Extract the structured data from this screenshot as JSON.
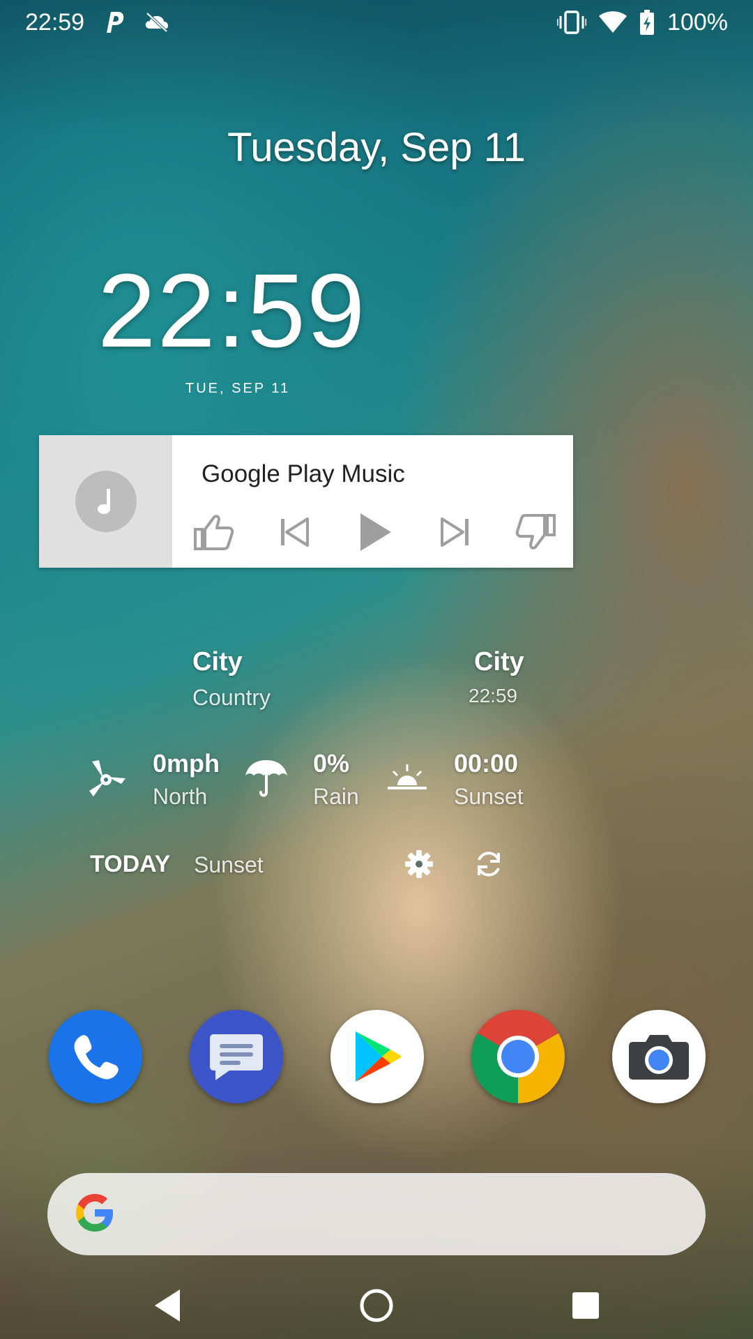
{
  "status_bar": {
    "time": "22:59",
    "battery": "100%",
    "icons": [
      "p-notification-icon",
      "cloud-off-icon",
      "vibrate-icon",
      "wifi-icon",
      "battery-charging-icon"
    ]
  },
  "glance": {
    "date": "Tuesday, Sep 11"
  },
  "clock": {
    "time": "22:59",
    "date": "TUE, SEP 11"
  },
  "music_widget": {
    "title": "Google Play Music",
    "controls": [
      "thumbs-up-icon",
      "skip-previous-icon",
      "play-icon",
      "skip-next-icon",
      "thumbs-down-icon"
    ]
  },
  "weather": {
    "location_city": "City",
    "location_country": "Country",
    "right_city": "City",
    "right_time": "22:59",
    "wind_value": "0mph",
    "wind_dir": "North",
    "rain_value": "0%",
    "rain_label": "Rain",
    "sunset_value": "00:00",
    "sunset_label": "Sunset",
    "today_label": "TODAY",
    "today_value": "Sunset"
  },
  "dock": {
    "apps": [
      "Phone",
      "Messages",
      "Play Store",
      "Chrome",
      "Camera"
    ],
    "colors": {
      "phone": "#1a73e8",
      "messages": "#3c55c9",
      "chrome_red": "#db4437",
      "chrome_yellow": "#f4b400",
      "chrome_green": "#0f9d58",
      "chrome_blue": "#4285f4"
    }
  },
  "search_bar": {
    "logo": "G"
  },
  "nav_bar": {
    "buttons": [
      "back-icon",
      "home-icon",
      "recents-icon"
    ]
  }
}
